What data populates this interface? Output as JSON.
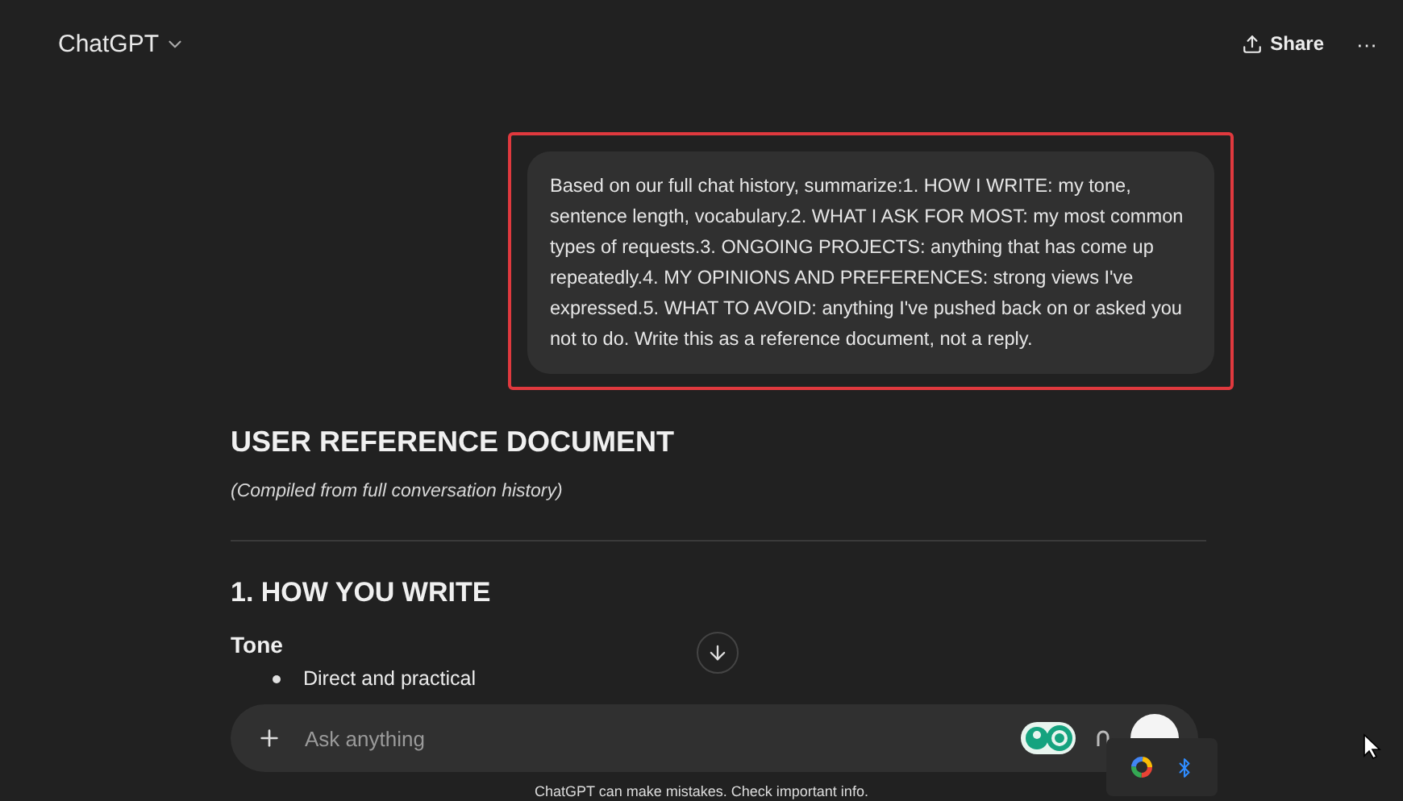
{
  "header": {
    "title": "ChatGPT",
    "share": "Share",
    "more": "···"
  },
  "message": {
    "text": "Based on our full chat history, summarize:1. HOW I WRITE: my tone, sentence length, vocabulary.2. WHAT I ASK FOR MOST: my most common types of requests.3. ONGOING PROJECTS: anything that has come up repeatedly.4. MY OPINIONS AND PREFERENCES: strong views I've expressed.5. WHAT TO AVOID: anything I've pushed back on or asked you not to do. Write this as a reference document, not a reply.",
    "highlighted": true
  },
  "document": {
    "title": "USER REFERENCE DOCUMENT",
    "subtitle": "(Compiled from full conversation history)",
    "sections": [
      {
        "heading": "1. HOW YOU WRITE",
        "subsections": [
          {
            "heading": "Tone",
            "bullets": [
              "Direct and practical"
            ]
          }
        ]
      }
    ]
  },
  "composer": {
    "placeholder": "Ask anything"
  },
  "disclaimer": "ChatGPT can make mistakes. Check important info."
}
